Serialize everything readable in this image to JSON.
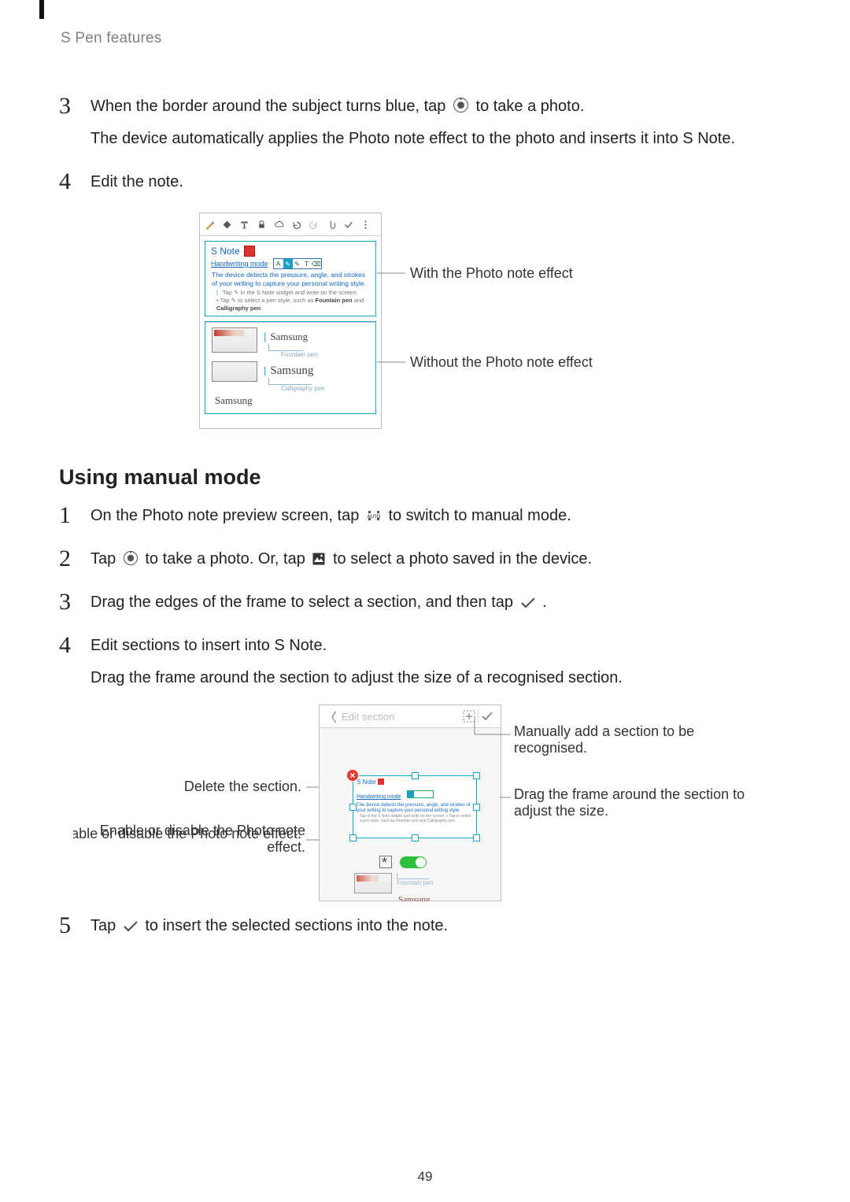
{
  "chapter": "S Pen features",
  "page_number": "49",
  "steps_a": {
    "3": {
      "line1_a": "When the border around the subject turns blue, tap ",
      "line1_b": " to take a photo.",
      "line2": "The device automatically applies the Photo note effect to the photo and inserts it into S Note."
    },
    "4": {
      "line1": "Edit the note."
    }
  },
  "section_heading": "Using manual mode",
  "steps_b": {
    "1": {
      "a": "On the Photo note preview screen, tap ",
      "b": " to switch to manual mode."
    },
    "2": {
      "a": "Tap ",
      "b": " to take a photo. Or, tap ",
      "c": " to select a photo saved in the device."
    },
    "3": {
      "a": "Drag the edges of the frame to select a section, and then tap ",
      "b": "."
    },
    "4": {
      "line1": "Edit sections to insert into S Note.",
      "line2": "Drag the frame around the section to adjust the size of a recognised section."
    },
    "5": {
      "a": "Tap ",
      "b": " to insert the selected sections into the note."
    }
  },
  "fig1": {
    "snote_label": "S Note",
    "hw_label": "Handwriting mode",
    "desc_line": "The device detects the pressure, angle, and strokes of your writing to capture your personal writing style.",
    "tip_a": "Tap ",
    "tip_b": " in the S Note widget and write on the screen.",
    "tip2_a": "• Tap ",
    "tip2_b": " to select a pen style, such as ",
    "tip2_bold1": "Fountain pen",
    "tip2_mid": " and ",
    "tip2_bold2": "Calligraphy pen",
    "tip2_end": ".",
    "sample1_cap": "Fountain pen",
    "sample2_cap": "Calligraphy pen",
    "sample_word": "Samsung",
    "callout_with": "With the Photo note effect",
    "callout_without": "Without the Photo note effect"
  },
  "fig2": {
    "editbar_title": "Edit section",
    "callout_add": "Manually add a section to be recognised.",
    "callout_delete": "Delete the section.",
    "callout_drag": "Drag the frame around the section to adjust the size.",
    "callout_effect": "Enable or disable the Photo note effect.",
    "inner_snote": "S Note",
    "inner_hw": "Handwriting mode",
    "inner_desc": "The device detects the pressure, angle, and strokes of your writing to capture your personal writing style.",
    "inner_tip": "Tap  in the S Note widget and write on the screen. • Tap  to select a pen style, such as Fountain pen and Calligraphy pen.",
    "inner_fountain": "Fountain pen",
    "inner_samsung": "Samsung"
  }
}
